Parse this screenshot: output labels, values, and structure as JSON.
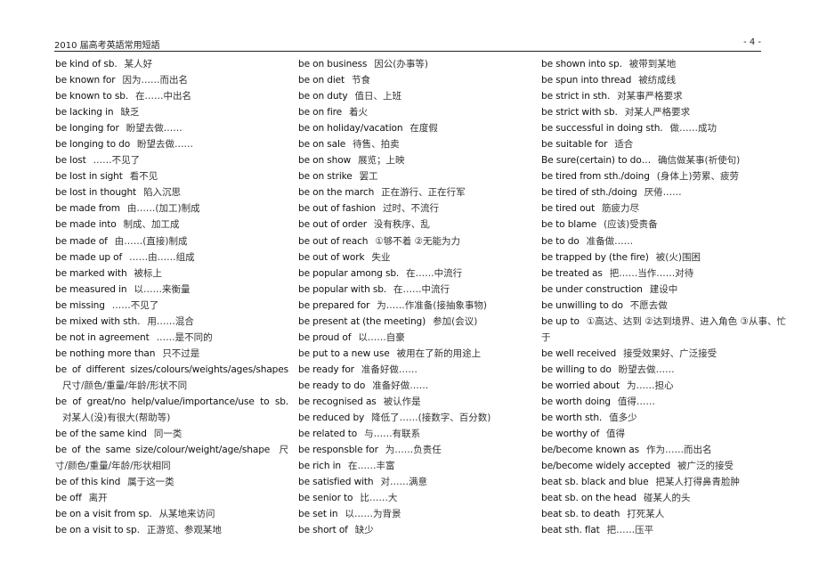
{
  "header": {
    "title": "2010 届高考英語常用短語",
    "page_number": "- 4 -"
  },
  "columns": [
    [
      {
        "en": "be kind of sb.",
        "zh": "某人好"
      },
      {
        "en": "be known for",
        "zh": "因为……而出名"
      },
      {
        "en": "be known to sb.",
        "zh": "在……中出名"
      },
      {
        "en": "be lacking in",
        "zh": "缺乏"
      },
      {
        "en": "be longing for",
        "zh": "盼望去做……"
      },
      {
        "en": "be longing to do",
        "zh": "盼望去做……"
      },
      {
        "en": "be lost",
        "zh": "……不见了"
      },
      {
        "en": "be lost in sight",
        "zh": "看不见"
      },
      {
        "en": "be lost in thought",
        "zh": "陷入沉思"
      },
      {
        "en": "be made from",
        "zh": "由……(加工)制成"
      },
      {
        "en": "be made into",
        "zh": "制成、加工成"
      },
      {
        "en": "be made of",
        "zh": "由……(直接)制成"
      },
      {
        "en": "be made up of",
        "zh": "……由……组成"
      },
      {
        "en": "be marked with",
        "zh": "被标上"
      },
      {
        "en": "be measured in",
        "zh": "以……来衡量"
      },
      {
        "en": "be missing",
        "zh": "……不见了"
      },
      {
        "en": "be mixed with sth.",
        "zh": "用……混合"
      },
      {
        "en": "be not in agreement",
        "zh": "……是不同的"
      },
      {
        "en": "be nothing more than",
        "zh": "只不过是"
      },
      {
        "en": "be of different sizes/colours/weights/ages/shapes",
        "zh": "尺寸/颜色/重量/年龄/形状不同",
        "wrap": true
      },
      {
        "en": "be of great/no help/value/importance/use to sb.",
        "zh": "对某人(没)有很大(帮助等)",
        "wrap": true
      },
      {
        "en": "be of the same kind",
        "zh": "同一类"
      },
      {
        "en": "be of the same size/colour/weight/age/shape",
        "zh": "尺寸/颜色/重量/年龄/形状相同",
        "wrap": true
      },
      {
        "en": "be of this kind",
        "zh": "属于这一类"
      },
      {
        "en": "be off",
        "zh": "离开"
      },
      {
        "en": "be on a visit from sp.",
        "zh": "从某地来访问"
      },
      {
        "en": "be on a visit to sp.",
        "zh": "正游览、参观某地"
      }
    ],
    [
      {
        "en": "be on business",
        "zh": "因公(办事等)"
      },
      {
        "en": "be on diet",
        "zh": "节食"
      },
      {
        "en": "be on duty",
        "zh": "值日、上班"
      },
      {
        "en": "be on fire",
        "zh": "着火"
      },
      {
        "en": "be on holiday/vacation",
        "zh": "在度假"
      },
      {
        "en": "be on sale",
        "zh": "待售、拍卖"
      },
      {
        "en": "be on show",
        "zh": "展览；上映"
      },
      {
        "en": "be on strike",
        "zh": "罢工"
      },
      {
        "en": "be on the march",
        "zh": "正在游行、正在行军"
      },
      {
        "en": "be out of fashion",
        "zh": "过时、不流行"
      },
      {
        "en": "be out of order",
        "zh": "没有秩序、乱"
      },
      {
        "en": "be out of reach",
        "zh": "①够不着 ②无能为力"
      },
      {
        "en": "be out of work",
        "zh": "失业"
      },
      {
        "en": "be popular among sb.",
        "zh": "在……中流行"
      },
      {
        "en": "be popular with sb.",
        "zh": "在……中流行"
      },
      {
        "en": "be prepared for",
        "zh": "为……作准备(接抽象事物)"
      },
      {
        "en": "be present at (the meeting)",
        "zh": "参加(会议)"
      },
      {
        "en": "be proud of",
        "zh": "以……自豪"
      },
      {
        "en": "be put to a new use",
        "zh": "被用在了新的用途上"
      },
      {
        "en": "be ready for",
        "zh": "准备好做……"
      },
      {
        "en": "be ready to do",
        "zh": "准备好做……"
      },
      {
        "en": "be recognised as",
        "zh": "被认作是"
      },
      {
        "en": "be reduced by",
        "zh": "降低了……(接数字、百分数)"
      },
      {
        "en": "be related to",
        "zh": "与……有联系"
      },
      {
        "en": "be responsble for",
        "zh": "为……负责任"
      },
      {
        "en": "be rich in",
        "zh": "在……丰富"
      },
      {
        "en": "be satisfied with",
        "zh": "对……满意"
      },
      {
        "en": "be senior to",
        "zh": "比……大"
      },
      {
        "en": "be set in",
        "zh": "以……为背景"
      },
      {
        "en": "be short of",
        "zh": "缺少"
      }
    ],
    [
      {
        "en": "be shown into sp.",
        "zh": "被带到某地"
      },
      {
        "en": "be spun into thread",
        "zh": "被纺成线"
      },
      {
        "en": "be strict in sth.",
        "zh": "对某事严格要求"
      },
      {
        "en": "be strict with sb.",
        "zh": "对某人严格要求"
      },
      {
        "en": "be successful in doing sth.",
        "zh": "做……成功"
      },
      {
        "en": "be suitable for",
        "zh": "适合"
      },
      {
        "en": "Be sure(certain) to do…",
        "zh": "确信做某事(祈使句)"
      },
      {
        "en": "be tired from sth./doing",
        "zh": "(身体上)劳累、疲劳"
      },
      {
        "en": "be tired of sth./doing",
        "zh": "厌倦……"
      },
      {
        "en": "be tired out",
        "zh": "筋疲力尽"
      },
      {
        "en": "be to blame",
        "zh": "(应该)受责备"
      },
      {
        "en": "be to do",
        "zh": "准备做……"
      },
      {
        "en": "be trapped by (the fire)",
        "zh": "被(火)围困"
      },
      {
        "en": "be treated as",
        "zh": "把……当作……对待"
      },
      {
        "en": "be under construction",
        "zh": "建设中"
      },
      {
        "en": "be unwilling to do",
        "zh": "不愿去做"
      },
      {
        "en": "be up to",
        "zh": "①高达、达到 ②达到境界、进入角色 ③从事、忙于",
        "wrap": true
      },
      {
        "en": "be well received",
        "zh": "接受效果好、广泛接受"
      },
      {
        "en": "be willing to do",
        "zh": "盼望去做……"
      },
      {
        "en": "be worried about",
        "zh": "为……担心"
      },
      {
        "en": "be worth doing",
        "zh": "值得……"
      },
      {
        "en": "be worth sth.",
        "zh": "值多少"
      },
      {
        "en": "be worthy of",
        "zh": "值得"
      },
      {
        "en": "be/become known as",
        "zh": "作为……而出名"
      },
      {
        "en": "be/become widely accepted",
        "zh": "被广泛的接受"
      },
      {
        "en": "beat sb. black and blue",
        "zh": "把某人打得鼻青脸肿"
      },
      {
        "en": "beat sb. on the head",
        "zh": "碰某人的头"
      },
      {
        "en": "beat sb. to death",
        "zh": "打死某人"
      },
      {
        "en": "beat sth. flat",
        "zh": "把……压平"
      }
    ]
  ]
}
